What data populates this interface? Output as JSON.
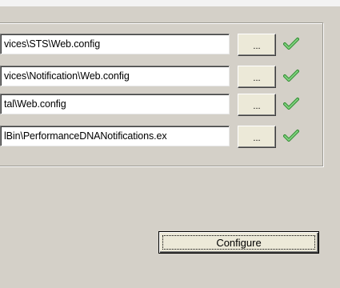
{
  "paths": [
    {
      "value": "vices\\STS\\Web.config"
    },
    {
      "value": "vices\\Notification\\Web.config"
    },
    {
      "value": "tal\\Web.config"
    },
    {
      "value": "lBin\\PerformanceDNANotifications.ex"
    }
  ],
  "browse_label": "...",
  "status_icon": "green-checkmark-icon",
  "configure_label": "Configure",
  "colors": {
    "dialog_bg": "#d4d0c8",
    "check_green": "#5cb85c"
  }
}
